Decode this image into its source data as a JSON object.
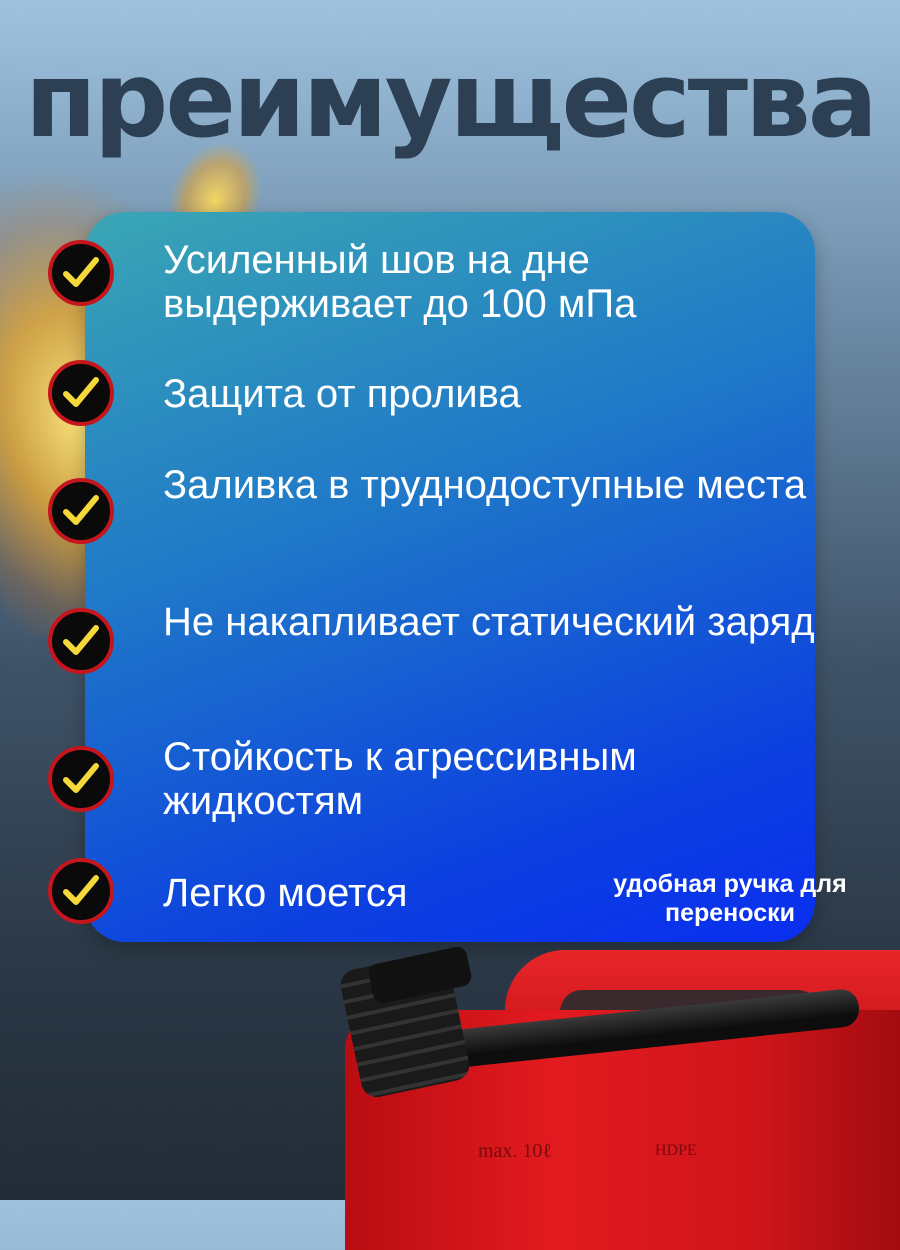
{
  "title": "преимущества",
  "items": [
    {
      "text": "Усиленный шов на дне выдерживает до 100 мПа",
      "icon": "check-icon"
    },
    {
      "text": "Защита от пролива",
      "icon": "check-icon"
    },
    {
      "text": "Заливка в труднодоступные места",
      "icon": "check-icon"
    },
    {
      "text": "Не накапливает статический заряд",
      "icon": "check-icon"
    },
    {
      "text": "Стойкость к агрессивным жидкостям",
      "icon": "check-icon"
    },
    {
      "text": "Легко моется",
      "icon": "check-icon"
    }
  ],
  "handle_note": "удобная ручка для переноски",
  "product": {
    "marking_capacity": "max. 10ℓ",
    "marking_material": "HDPE"
  },
  "colors": {
    "title": "#2d3f52",
    "panel_start": "#3aa6b4",
    "panel_end": "#0a2ef0",
    "check_mark": "#f5d83a",
    "check_border": "#c4161c",
    "canister": "#e21a1f"
  }
}
